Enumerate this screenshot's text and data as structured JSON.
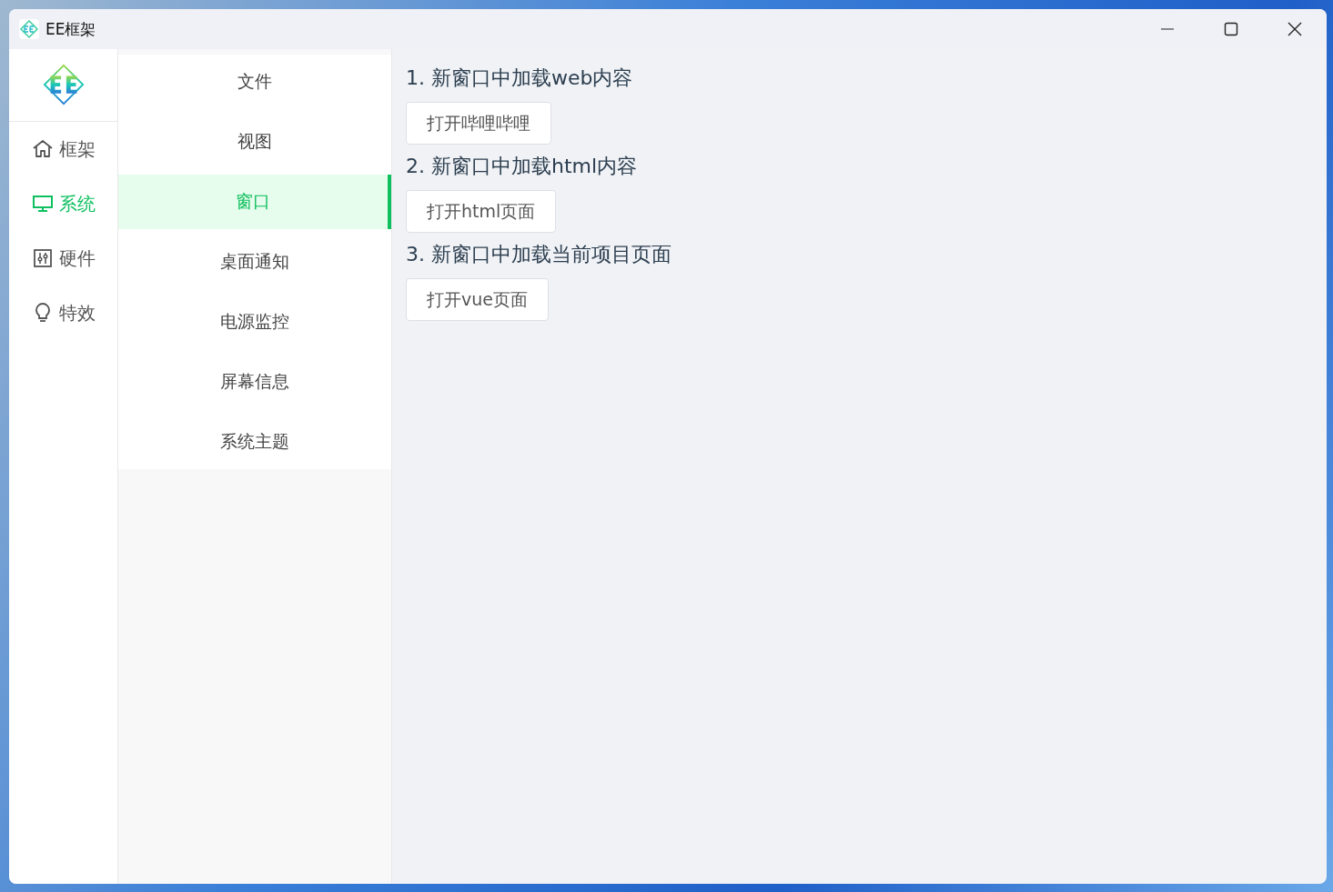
{
  "window": {
    "title": "EE框架"
  },
  "sidebar": {
    "items": [
      {
        "label": "框架",
        "selected": false
      },
      {
        "label": "系统",
        "selected": true
      },
      {
        "label": "硬件",
        "selected": false
      },
      {
        "label": "特效",
        "selected": false
      }
    ]
  },
  "menu": {
    "items": [
      {
        "label": "文件",
        "selected": false
      },
      {
        "label": "视图",
        "selected": false
      },
      {
        "label": "窗口",
        "selected": true
      },
      {
        "label": "桌面通知",
        "selected": false
      },
      {
        "label": "电源监控",
        "selected": false
      },
      {
        "label": "屏幕信息",
        "selected": false
      },
      {
        "label": "系统主题",
        "selected": false
      }
    ]
  },
  "sections": [
    {
      "heading": "1. 新窗口中加载web内容",
      "button": "打开哔哩哔哩"
    },
    {
      "heading": "2. 新窗口中加载html内容",
      "button": "打开html页面"
    },
    {
      "heading": "3. 新窗口中加载当前项目页面",
      "button": "打开vue页面"
    }
  ]
}
